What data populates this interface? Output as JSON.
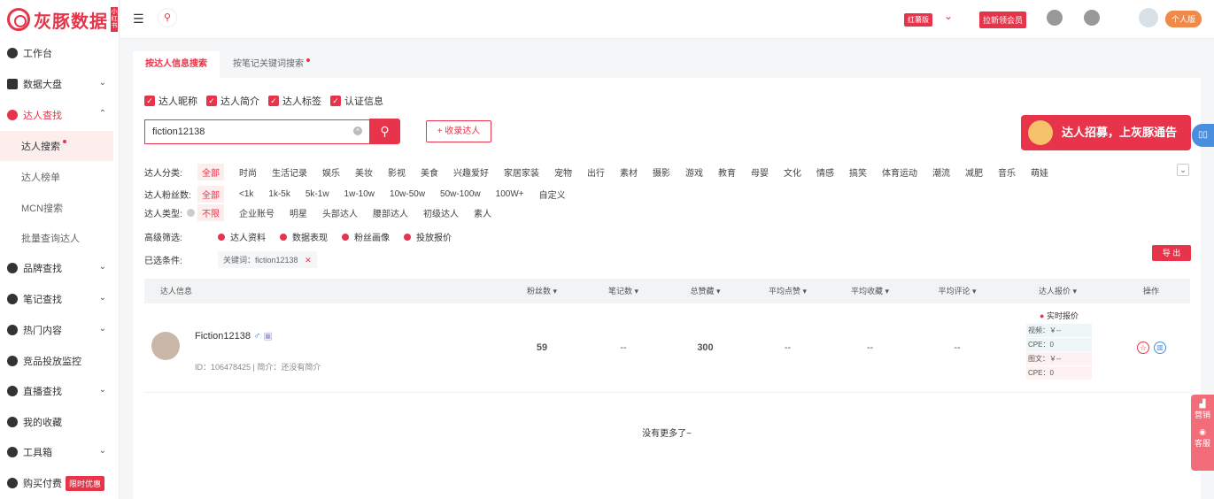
{
  "brand": {
    "name": "灰豚数据",
    "tag": "小红书"
  },
  "sidebar": {
    "items": [
      {
        "label": "工作台"
      },
      {
        "label": "数据大盘"
      },
      {
        "label": "达人查找"
      },
      {
        "label": "品牌查找"
      },
      {
        "label": "笔记查找"
      },
      {
        "label": "热门内容"
      },
      {
        "label": "竞品投放监控"
      },
      {
        "label": "直播查找"
      },
      {
        "label": "我的收藏"
      },
      {
        "label": "工具箱"
      },
      {
        "label": "购买付费"
      }
    ],
    "sub": [
      {
        "label": "达人搜索"
      },
      {
        "label": "达人榜单"
      },
      {
        "label": "MCN搜索"
      },
      {
        "label": "批量查询达人"
      }
    ],
    "promo": "限时优惠"
  },
  "topbar": {
    "version": "红薯版",
    "invite": "拉新领会员",
    "personal": "个人版"
  },
  "tabs": [
    {
      "label": "按达人信息搜索"
    },
    {
      "label": "按笔记关键词搜索"
    }
  ],
  "checks": [
    "达人昵称",
    "达人简介",
    "达人标签",
    "认证信息"
  ],
  "search": {
    "value": "fiction12138",
    "collect": "+ 收录达人"
  },
  "banner": "达人招募，上灰豚通告 →",
  "filters": {
    "category_label": "达人分类:",
    "categories": [
      "全部",
      "时尚",
      "生活记录",
      "娱乐",
      "美妆",
      "影视",
      "美食",
      "兴趣爱好",
      "家居家装",
      "宠物",
      "出行",
      "素材",
      "摄影",
      "游戏",
      "教育",
      "母婴",
      "文化",
      "情感",
      "搞笑",
      "体育运动",
      "潮流",
      "减肥",
      "音乐",
      "萌娃"
    ],
    "fans_label": "达人粉丝数:",
    "fans": [
      "全部",
      "<1k",
      "1k-5k",
      "5k-1w",
      "1w-10w",
      "10w-50w",
      "50w-100w",
      "100W+",
      "自定义"
    ],
    "type_label": "达人类型:",
    "types": [
      "不限",
      "企业账号",
      "明星",
      "头部达人",
      "腰部达人",
      "初级达人",
      "素人"
    ],
    "adv_label": "高级筛选:",
    "adv": [
      "达人资料",
      "数据表现",
      "粉丝画像",
      "投放报价"
    ],
    "sel_label": "已选条件:",
    "sel_tag": "关键词：fiction12138",
    "export": "导 出"
  },
  "table": {
    "headers": [
      "达人信息",
      "粉丝数 ▾",
      "笔记数 ▾",
      "总赞藏 ▾",
      "平均点赞 ▾",
      "平均收藏 ▾",
      "平均评论 ▾",
      "达人报价 ▾",
      "操作"
    ],
    "row": {
      "name": "Fiction12138",
      "meta": "ID：106478425 | 简介：还没有简介",
      "fans": "59",
      "notes": "--",
      "likes": "300",
      "avg_like": "--",
      "avg_fav": "--",
      "avg_cmt": "--",
      "quote_title": "实时报价",
      "video": "视频：￥--",
      "cpe1": "CPE：0",
      "image": "图文：￥--",
      "cpe2": "CPE：0"
    },
    "end": "没有更多了~"
  },
  "float": {
    "market": "营销",
    "service": "客服"
  }
}
